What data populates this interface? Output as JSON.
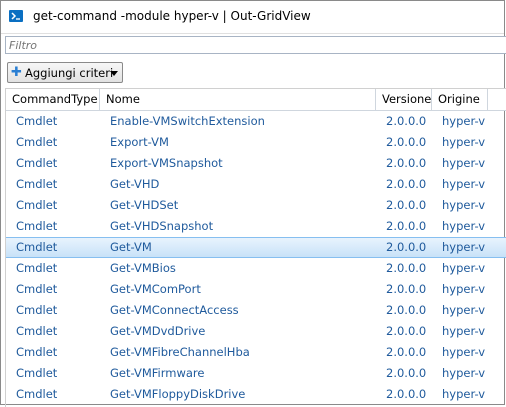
{
  "window": {
    "title": "get-command -module hyper-v | Out-GridView",
    "icon": "powershell-icon"
  },
  "filter": {
    "placeholder": "Filtro",
    "value": ""
  },
  "toolbar": {
    "add_criteria_label": "Aggiungi criteri",
    "add_icon": "plus-icon",
    "dropdown_icon": "chevron-down-icon"
  },
  "grid": {
    "columns": [
      "CommandType",
      "Nome",
      "Versione",
      "Origine"
    ],
    "selected_row": 6,
    "rows": [
      {
        "type": "Cmdlet",
        "name": "Enable-VMSwitchExtension",
        "version": "2.0.0.0",
        "source": "hyper-v"
      },
      {
        "type": "Cmdlet",
        "name": "Export-VM",
        "version": "2.0.0.0",
        "source": "hyper-v"
      },
      {
        "type": "Cmdlet",
        "name": "Export-VMSnapshot",
        "version": "2.0.0.0",
        "source": "hyper-v"
      },
      {
        "type": "Cmdlet",
        "name": "Get-VHD",
        "version": "2.0.0.0",
        "source": "hyper-v"
      },
      {
        "type": "Cmdlet",
        "name": "Get-VHDSet",
        "version": "2.0.0.0",
        "source": "hyper-v"
      },
      {
        "type": "Cmdlet",
        "name": "Get-VHDSnapshot",
        "version": "2.0.0.0",
        "source": "hyper-v"
      },
      {
        "type": "Cmdlet",
        "name": "Get-VM",
        "version": "2.0.0.0",
        "source": "hyper-v"
      },
      {
        "type": "Cmdlet",
        "name": "Get-VMBios",
        "version": "2.0.0.0",
        "source": "hyper-v"
      },
      {
        "type": "Cmdlet",
        "name": "Get-VMComPort",
        "version": "2.0.0.0",
        "source": "hyper-v"
      },
      {
        "type": "Cmdlet",
        "name": "Get-VMConnectAccess",
        "version": "2.0.0.0",
        "source": "hyper-v"
      },
      {
        "type": "Cmdlet",
        "name": "Get-VMDvdDrive",
        "version": "2.0.0.0",
        "source": "hyper-v"
      },
      {
        "type": "Cmdlet",
        "name": "Get-VMFibreChannelHba",
        "version": "2.0.0.0",
        "source": "hyper-v"
      },
      {
        "type": "Cmdlet",
        "name": "Get-VMFirmware",
        "version": "2.0.0.0",
        "source": "hyper-v"
      },
      {
        "type": "Cmdlet",
        "name": "Get-VMFloppyDiskDrive",
        "version": "2.0.0.0",
        "source": "hyper-v"
      }
    ]
  }
}
